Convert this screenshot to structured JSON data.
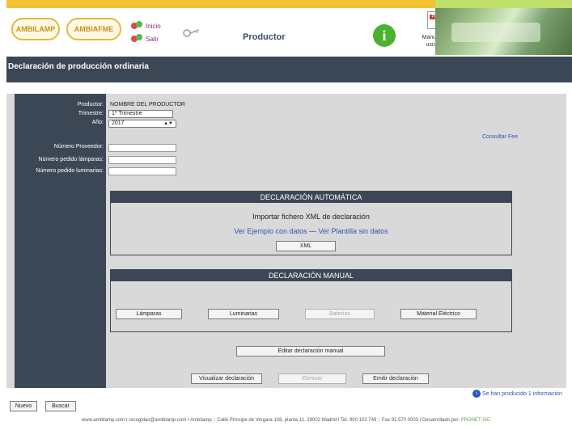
{
  "header": {
    "logo1": "AMBILAMP",
    "logo2": "AMBIAFME",
    "nav": {
      "inicio": "Inicio",
      "salir": "Salir"
    },
    "title": "Productor",
    "manual_label": "Manual de usuario",
    "pdf_tag": "PDF"
  },
  "page": {
    "title": "Declaración de producción ordinaria"
  },
  "form": {
    "productor_label": "Productor:",
    "productor_value": "NOMBRE DEL PRODUCTOR",
    "trimestre_label": "Trimestre:",
    "trimestre_value": "1º Trimestre",
    "anio_label": "Año:",
    "anio_value": "2017",
    "num_proveedor_label": "Número Proveedor:",
    "num_pedido_lamparas_label": "Número pedido lámparas:",
    "num_pedido_luminarias_label": "Número pedido luminarias:",
    "consultar_fee": "Consultar Fee"
  },
  "auto": {
    "header": "DECLARACIÓN AUTOMÁTICA",
    "import_title": "Importar fichero XML de declaración",
    "link_ejemplo": "Ver Ejemplo con datos",
    "separator": "---",
    "link_plantilla": "Ver Plantilla sin datos",
    "xml_button": "XML"
  },
  "manual": {
    "header": "DECLARACIÓN MANUAL",
    "btn_lamparas": "Lámparas",
    "btn_luminarias": "Luminarias",
    "btn_baterias": "Baterías",
    "btn_material": "Material Eléctrico",
    "btn_editar": "Editar declaración manual"
  },
  "actions": {
    "visualizar": "Visualizar declaración",
    "eliminar": "Eliminar",
    "emitir": "Emitir declaración"
  },
  "footer": {
    "nuevo": "Nuevo",
    "buscar": "Buscar",
    "info_text": "Se han producido 1 información",
    "bottom_left": "www.ambilamp.com I recogidas@ambilamp.com I Ambilamp :: Calle Príncipe de Vergara 108, planta 11. 28002 Madrid I Tel. 900 102 749 :: Fax 91 570 0003 I Desarrollado por:",
    "bottom_brand": "PRONET-ISE"
  },
  "colors": {
    "nav_dark": "#3c4756",
    "accent_yellow": "#f2c230",
    "accent_green": "#bfe06a",
    "link_blue": "#2a58b0"
  }
}
